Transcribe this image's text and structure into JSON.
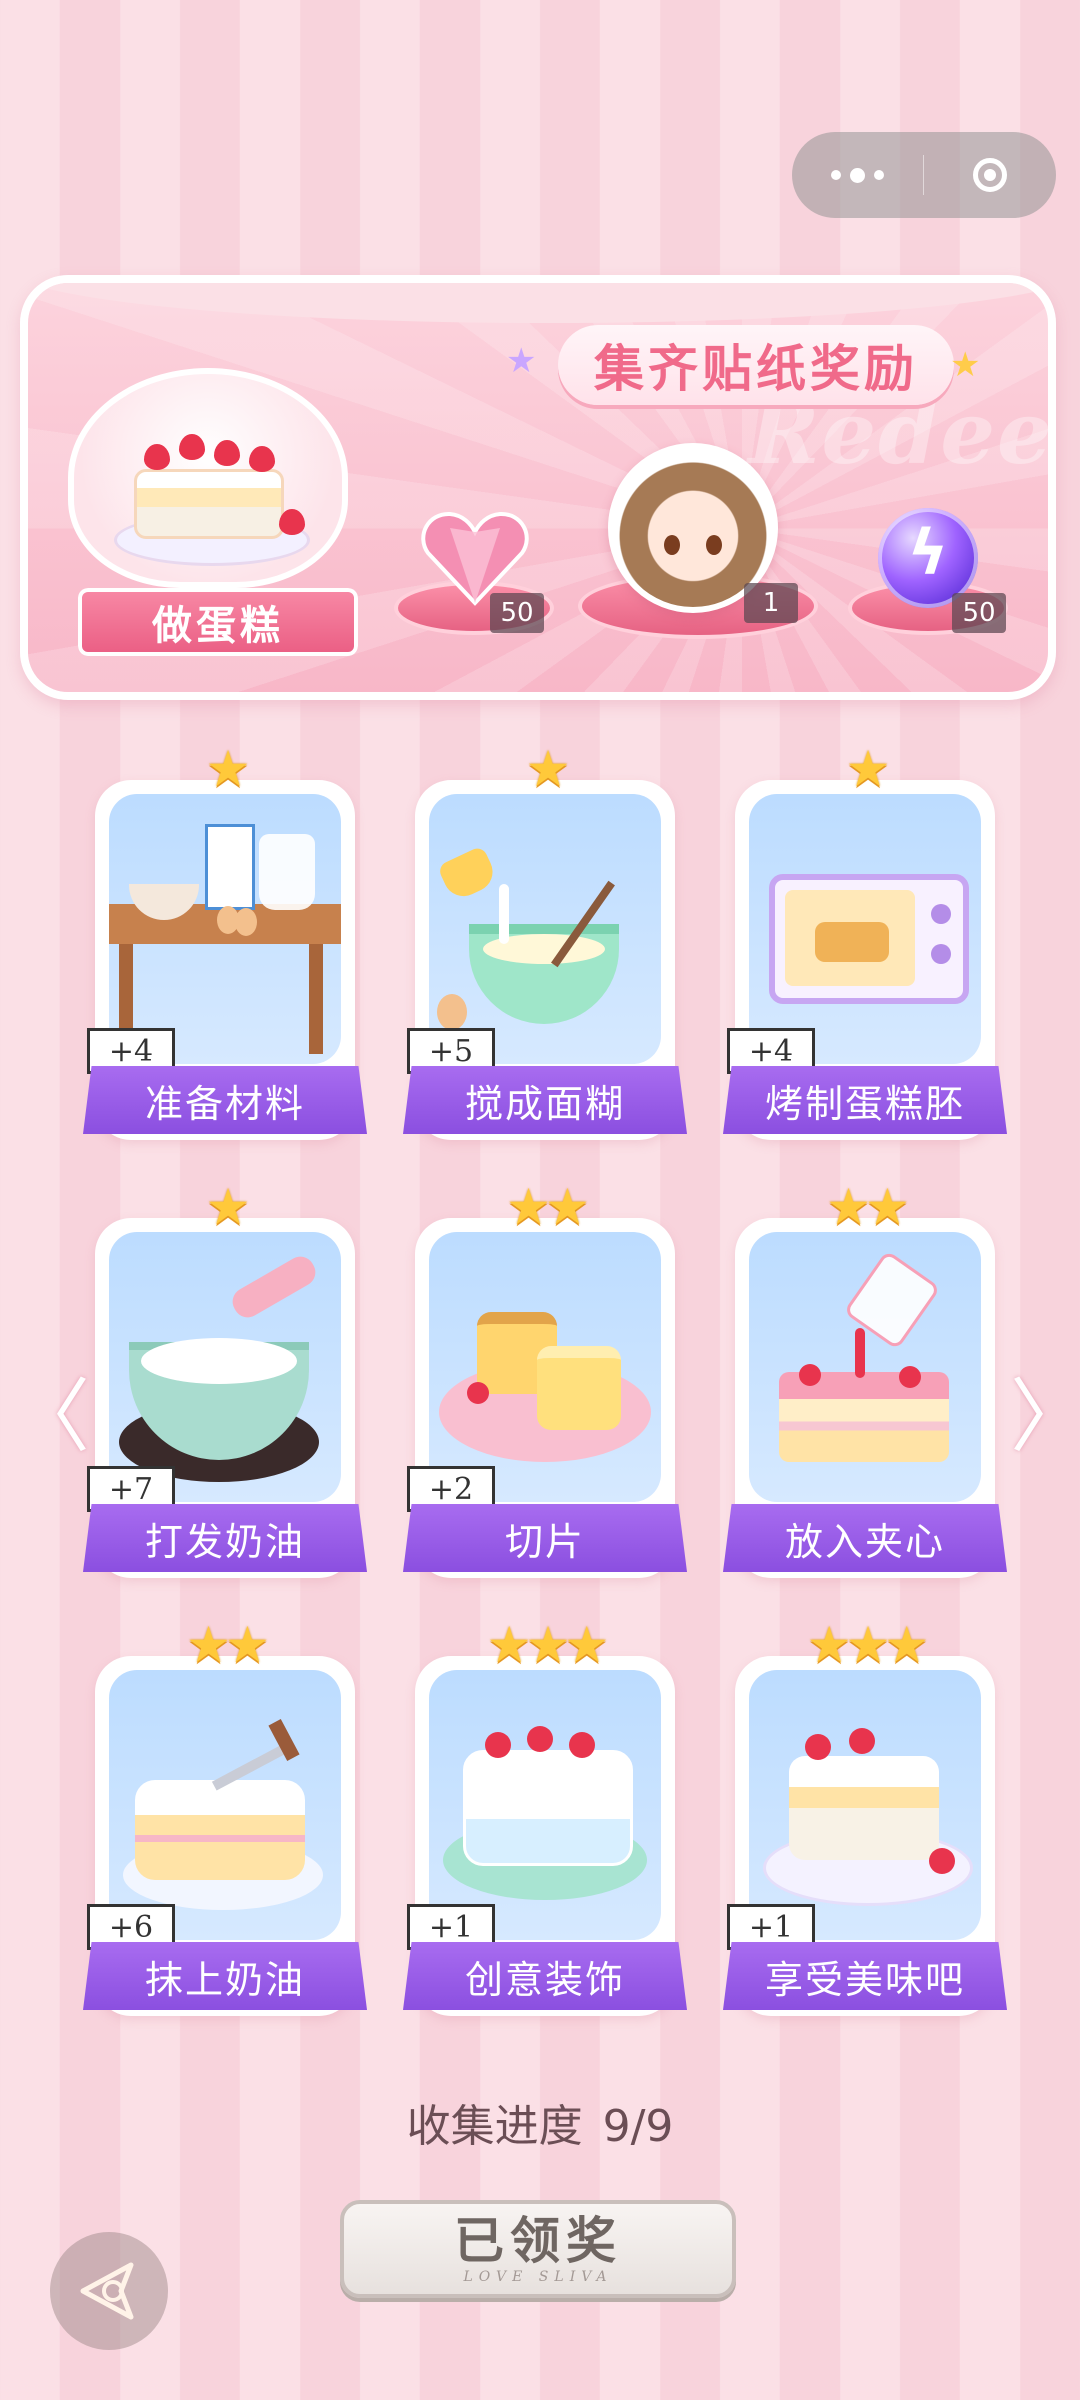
{
  "capsule": {
    "more_icon": "ellipsis-icon",
    "close_icon": "target-icon"
  },
  "banner": {
    "title": "集齐贴纸奖励",
    "watermark": "Redeem",
    "make_cake_label": "做蛋糕",
    "rewards": [
      {
        "name": "pink-heart-gem",
        "count": "50"
      },
      {
        "name": "avatar-frame",
        "count": "1"
      },
      {
        "name": "purple-energy-orb",
        "count": "50"
      }
    ]
  },
  "steps": [
    {
      "label": "准备材料",
      "bonus": "+4",
      "stars": "★"
    },
    {
      "label": "搅成面糊",
      "bonus": "+5",
      "stars": "★"
    },
    {
      "label": "烤制蛋糕胚",
      "bonus": "+4",
      "stars": "★"
    },
    {
      "label": "打发奶油",
      "bonus": "+7",
      "stars": "★"
    },
    {
      "label": "切片",
      "bonus": "+2",
      "stars": "★★"
    },
    {
      "label": "放入夹心",
      "bonus": "",
      "stars": "★★"
    },
    {
      "label": "抹上奶油",
      "bonus": "+6",
      "stars": "★★"
    },
    {
      "label": "创意装饰",
      "bonus": "+1",
      "stars": "★★★"
    },
    {
      "label": "享受美味吧",
      "bonus": "+1",
      "stars": "★★★"
    }
  ],
  "progress": {
    "label": "收集进度",
    "value": "9/9",
    "collected": 9,
    "total": 9
  },
  "claim_button": {
    "label": "已领奖",
    "subtext": "LOVE SLIVA"
  },
  "nav": {
    "left_arrow": "〈",
    "right_arrow": "〉"
  },
  "colors": {
    "accent": "#f06a8a",
    "label_purple": "#9a5ee8",
    "star": "#ffc93a"
  }
}
